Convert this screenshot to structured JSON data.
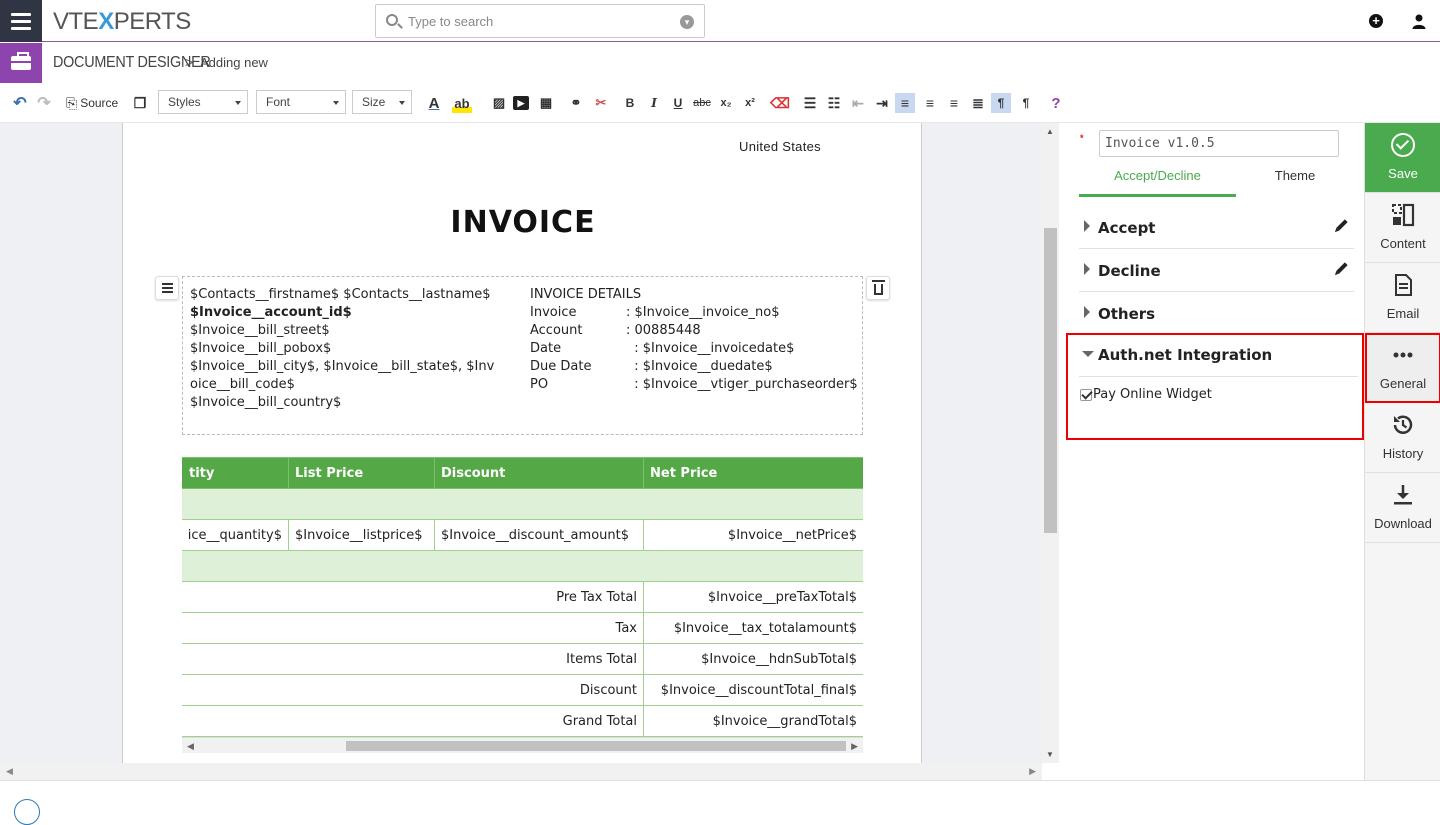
{
  "app": {
    "logo": {
      "vte": "VTE",
      "x": "X",
      "perts": "PERTS"
    },
    "search_placeholder": "Type to search"
  },
  "breadcrumb": {
    "module": "DOCUMENT DESIGNER",
    "separator": ">",
    "page": "Adding new"
  },
  "toolbar": {
    "source_label": "Source",
    "styles_label": "Styles",
    "font_label": "Font",
    "size_label": "Size",
    "help_label": "?"
  },
  "document": {
    "country": "United States",
    "title": "INVOICE",
    "address_lines": [
      "$Contacts__firstname$ $Contacts__lastname$",
      "$Invoice__account_id$",
      "$Invoice__bill_street$",
      "$Invoice__bill_pobox$",
      "$Invoice__bill_city$, $Invoice__bill_state$, $Inv",
      "oice__bill_code$",
      "$Invoice__bill_country$"
    ],
    "details_heading": "INVOICE DETAILS",
    "details": [
      {
        "key": "Invoice",
        "value": ": $Invoice__invoice_no$"
      },
      {
        "key": "Account",
        "value": ": 00885448"
      },
      {
        "key": "Date",
        "value": "  : $Invoice__invoicedate$"
      },
      {
        "key": "Due Date",
        "value": "  : $Invoice__duedate$"
      },
      {
        "key": "PO",
        "value": "  : $Invoice__vtiger_purchaseorder$"
      }
    ],
    "table": {
      "headers": [
        "tity",
        "List Price",
        "Discount",
        "Net Price"
      ],
      "row": [
        "ice__quantity$",
        "$Invoice__listprice$",
        "$Invoice__discount_amount$",
        "$Invoice__netPrice$"
      ],
      "totals": [
        {
          "label": "Pre Tax Total",
          "value": "$Invoice__preTaxTotal$"
        },
        {
          "label": "Tax",
          "value": "$Invoice__tax_totalamount$"
        },
        {
          "label": "Items Total",
          "value": "$Invoice__hdnSubTotal$"
        },
        {
          "label": "Discount",
          "value": "$Invoice__discountTotal_final$"
        },
        {
          "label": "Grand Total",
          "value": "$Invoice__grandTotal$"
        }
      ]
    }
  },
  "panel": {
    "required_mark": "*",
    "template_name": "Invoice v1.0.5",
    "tabs": [
      "Accept/Decline",
      "Theme"
    ],
    "sections": {
      "accept": "Accept",
      "decline": "Decline",
      "others": "Others",
      "auth": "Auth.net Integration"
    },
    "pay_online_label": "Pay Online Widget",
    "pay_online_checked": true
  },
  "sidebar": {
    "save": "Save",
    "content": "Content",
    "email": "Email",
    "general": "General",
    "history": "History",
    "download": "Download"
  },
  "colors": {
    "accent_green": "#4aaa4e",
    "table_header": "#55a846",
    "highlight_red": "#ee0000",
    "module_purple": "#8e44ad"
  }
}
